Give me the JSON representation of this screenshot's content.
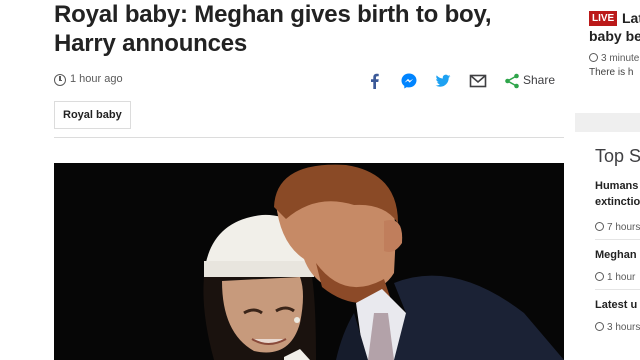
{
  "article": {
    "headline": "Royal baby: Meghan gives birth to boy, Harry announces",
    "timestamp": "1 hour ago",
    "share_label": "Share",
    "tag": "Royal baby"
  },
  "share_icons": [
    "facebook-icon",
    "messenger-icon",
    "twitter-icon",
    "email-icon",
    "share-icon"
  ],
  "colors": {
    "live_red": "#bb1919",
    "facebook": "#3b5998",
    "messenger": "#0084ff",
    "twitter": "#1da1f2",
    "share_green": "#2fa54b"
  },
  "sidebar": {
    "live": {
      "badge": "LIVE",
      "title_line1": "Lat",
      "title_line2": "baby be",
      "time": "3 minute",
      "desc": "There is h"
    },
    "top_stories": {
      "title": "Top S",
      "items": [
        {
          "line1": "Humans",
          "line2": "extinctio",
          "time": "7 hours"
        },
        {
          "line1": "Meghan",
          "line2": "",
          "time": "1 hour"
        },
        {
          "line1": "Latest u",
          "line2": "",
          "time": "3 hours"
        }
      ]
    }
  }
}
